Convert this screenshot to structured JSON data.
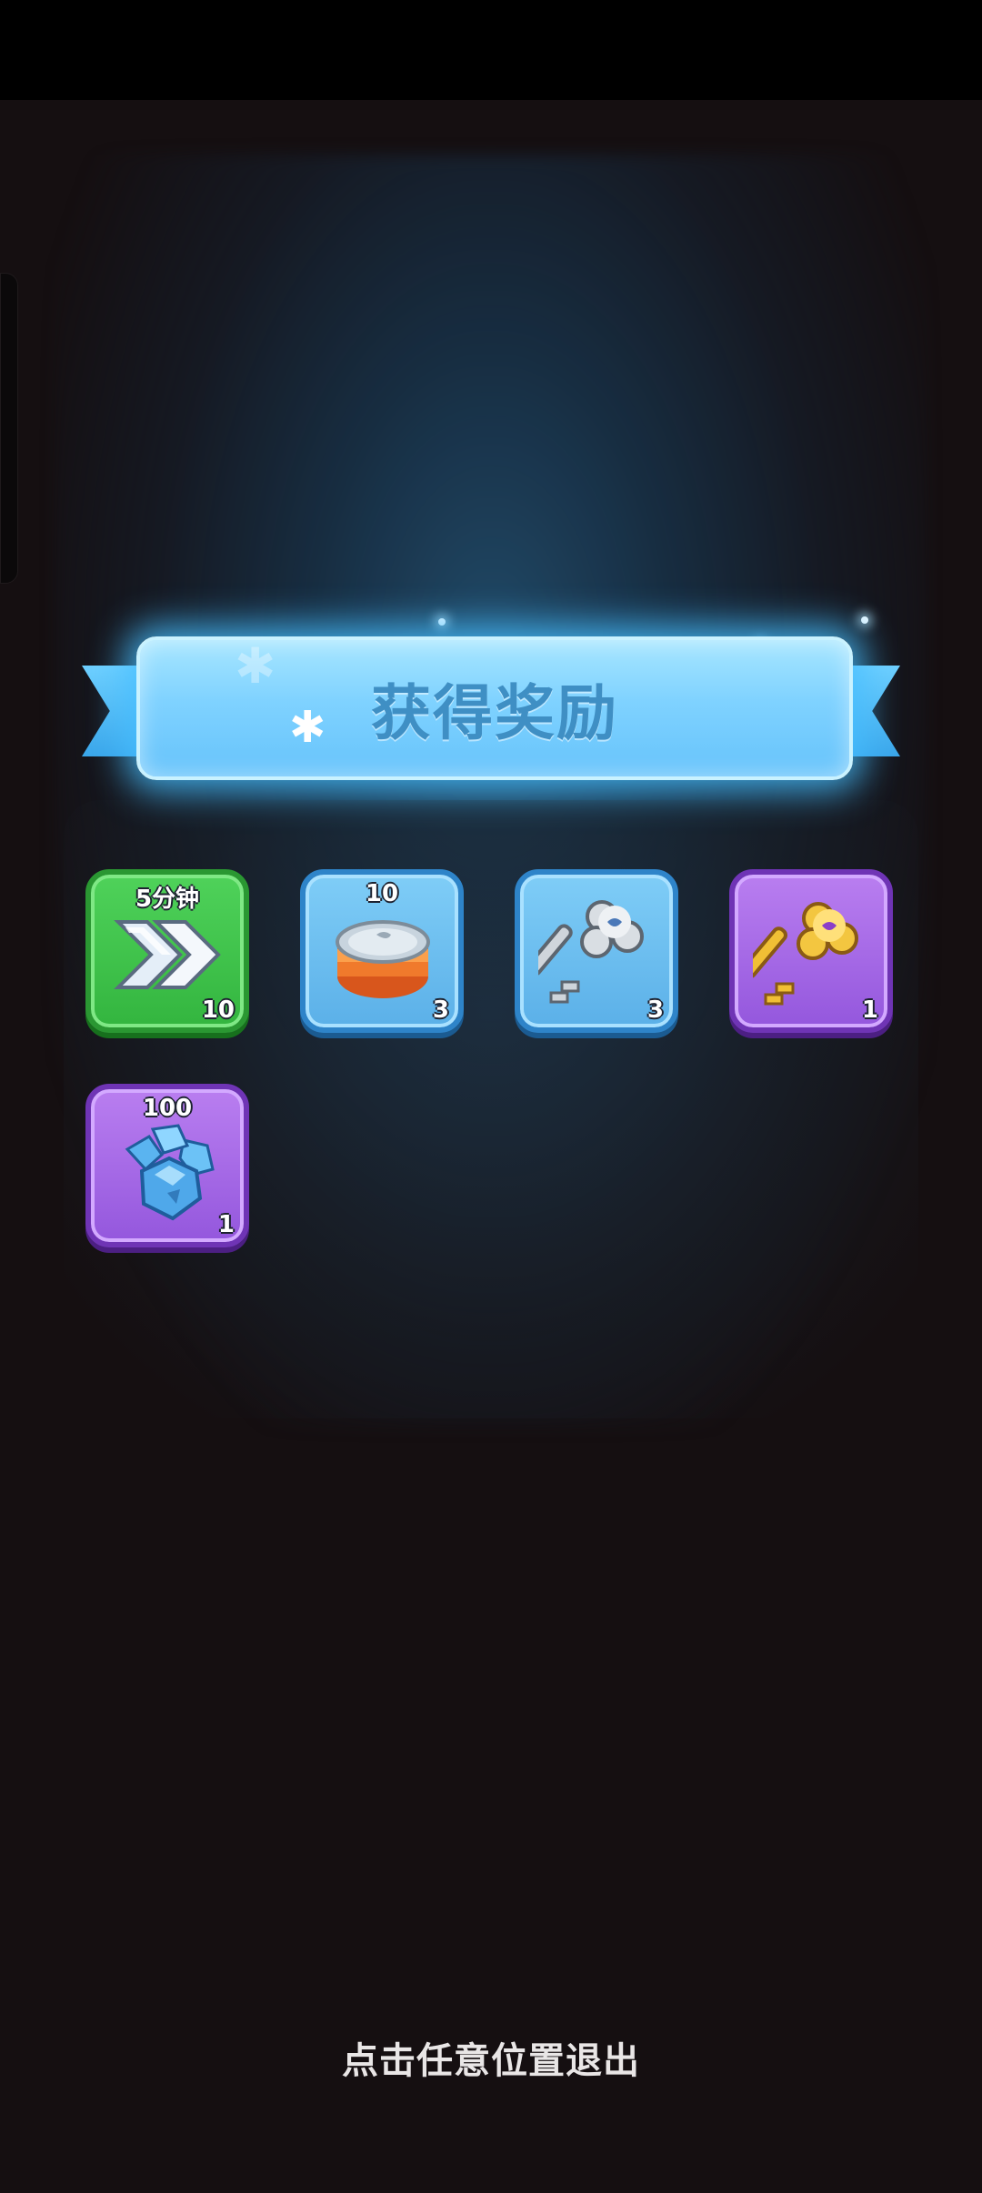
{
  "banner": {
    "title": "获得奖励"
  },
  "rewards": [
    {
      "name": "speedup",
      "icon": "double-chevron-speedup-icon",
      "frame": "green",
      "top_label": "5分钟",
      "count": "10"
    },
    {
      "name": "can",
      "icon": "food-can-icon",
      "frame": "blue",
      "top_label": "10",
      "count": "3"
    },
    {
      "name": "silver-key",
      "icon": "silver-key-icon",
      "frame": "blue",
      "top_label": "",
      "count": "3"
    },
    {
      "name": "gold-key",
      "icon": "gold-key-icon",
      "frame": "purple",
      "top_label": "",
      "count": "1"
    },
    {
      "name": "gems",
      "icon": "blue-gems-icon",
      "frame": "purple",
      "top_label": "100",
      "count": "1"
    }
  ],
  "footer": {
    "exit_hint": "点击任意位置退出"
  },
  "colors": {
    "background": "#150f11",
    "banner": "#7fd2ff",
    "banner_text": "#3f8fc4",
    "frame_green": "#33b53f",
    "frame_blue": "#5bb0e8",
    "frame_purple": "#9457dd"
  }
}
